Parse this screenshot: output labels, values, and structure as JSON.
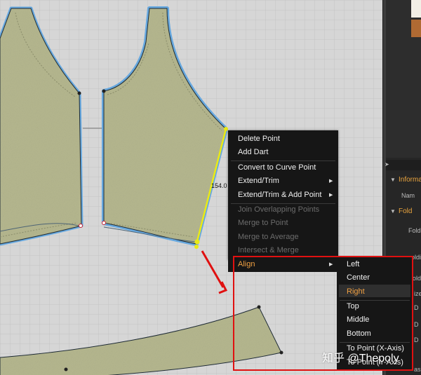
{
  "context_menu": {
    "items": [
      {
        "label": "Delete Point",
        "enabled": true
      },
      {
        "label": "Add Dart",
        "enabled": true
      },
      {
        "label": "Convert to Curve Point",
        "enabled": true
      },
      {
        "label": "Extend/Trim",
        "enabled": true,
        "submenu": true
      },
      {
        "label": "Extend/Trim & Add Point",
        "enabled": true,
        "submenu": true
      },
      {
        "label": "Join Overlapping Points",
        "enabled": false
      },
      {
        "label": "Merge to Point",
        "enabled": false
      },
      {
        "label": "Merge to Average",
        "enabled": false
      },
      {
        "label": "Intersect & Merge",
        "enabled": false
      }
    ],
    "align_label": "Align"
  },
  "submenu": {
    "items": [
      "Left",
      "Center",
      "Right",
      "Top",
      "Middle",
      "Bottom",
      "To Point (X-Axis)",
      "To Point (Y-Axis)"
    ],
    "highlighted": "Right"
  },
  "canvas": {
    "measurement": "154.0"
  },
  "property_panel": {
    "section_1": "Informa",
    "row_1": "Nam",
    "section_2": "Fold",
    "row_2": "Fold",
    "fragments": [
      "oldi",
      "oldi",
      "ize",
      "D",
      "D",
      "D",
      "as"
    ]
  },
  "watermark": "知乎 @Thepoly",
  "colors": {
    "fabric": "#b5b78f",
    "outline": "#66a8df",
    "selected_edge": "#eaea14",
    "annotation": "#e01010",
    "menu_bg": "#161616",
    "highlight_text": "#f0a042"
  }
}
